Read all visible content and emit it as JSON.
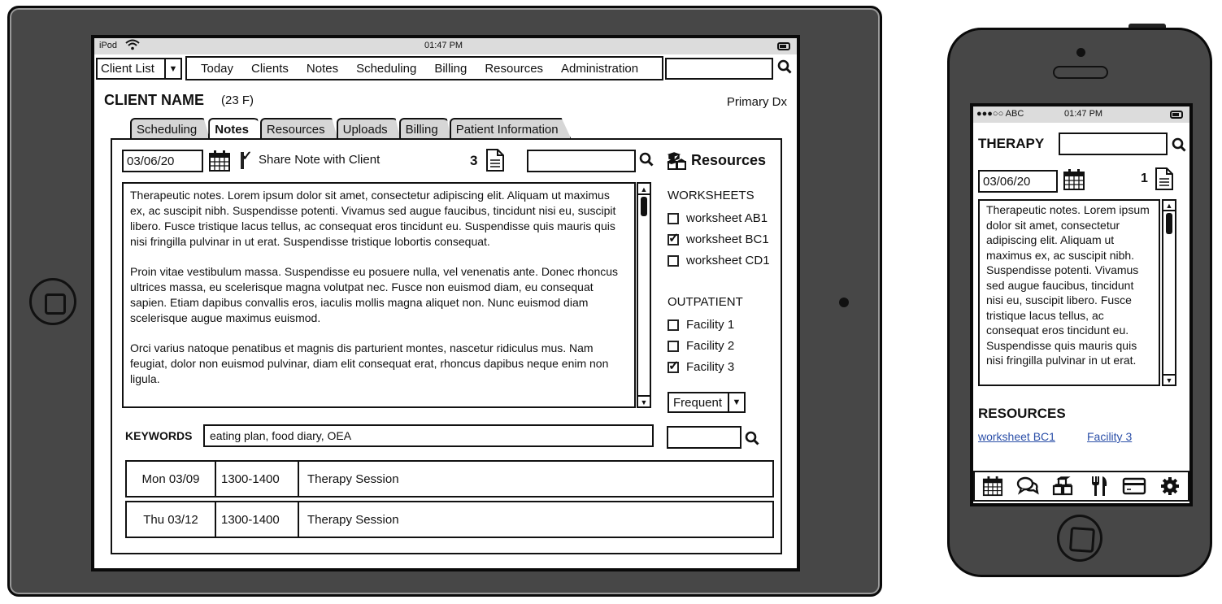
{
  "tablet": {
    "status_bar": {
      "carrier": "iPod",
      "time": "01:47 PM"
    },
    "nav": {
      "client_select": "Client List",
      "menu": [
        "Today",
        "Clients",
        "Notes",
        "Scheduling",
        "Billing",
        "Resources",
        "Administration"
      ],
      "search_placeholder": ""
    },
    "header": {
      "client_name": "CLIENT NAME",
      "client_info": "(23 F)",
      "primary_dx": "Primary Dx"
    },
    "tabs": [
      {
        "label": "Scheduling",
        "active": false
      },
      {
        "label": "Notes",
        "active": true
      },
      {
        "label": "Resources",
        "active": false
      },
      {
        "label": "Uploads",
        "active": false
      },
      {
        "label": "Billing",
        "active": false
      },
      {
        "label": "Patient Information",
        "active": false
      }
    ],
    "notes_panel": {
      "date": "03/06/20",
      "share_label": "Share Note with Client",
      "share_checked": true,
      "note_count": "3",
      "search_value": "",
      "paragraphs": [
        "Therapeutic notes. Lorem ipsum dolor sit amet, consectetur adipiscing elit. Aliquam ut maximus ex, ac suscipit nibh. Suspendisse potenti. Vivamus sed augue faucibus, tincidunt nisi eu, suscipit libero. Fusce tristique lacus tellus, ac consequat eros tincidunt eu. Suspendisse quis mauris quis nisi fringilla pulvinar in ut erat. Suspendisse tristique lobortis consequat.",
        "Proin vitae vestibulum massa. Suspendisse eu posuere nulla, vel venenatis ante. Donec rhoncus ultrices massa, eu scelerisque magna volutpat nec. Fusce non euismod diam, eu consequat sapien. Etiam dapibus convallis eros, iaculis mollis magna aliquet non. Nunc euismod diam scelerisque augue maximus euismod.",
        "Orci varius natoque penatibus et magnis dis parturient montes, nascetur ridiculus mus. Nam feugiat, dolor non euismod pulvinar, diam elit consequat erat, rhoncus dapibus neque enim non ligula."
      ],
      "keywords_label": "KEYWORDS",
      "keywords_value": "eating plan, food diary, OEA"
    },
    "resources": {
      "title": "Resources",
      "worksheets_heading": "WORKSHEETS",
      "worksheets": [
        {
          "label": "worksheet AB1",
          "checked": false
        },
        {
          "label": "worksheet BC1",
          "checked": true
        },
        {
          "label": "worksheet CD1",
          "checked": false
        }
      ],
      "outpatient_heading": "OUTPATIENT",
      "facilities": [
        {
          "label": "Facility 1",
          "checked": false
        },
        {
          "label": "Facility 2",
          "checked": false
        },
        {
          "label": "Facility 3",
          "checked": true
        }
      ],
      "frequency_select": "Frequent"
    },
    "schedule": [
      {
        "day": "Mon 03/09",
        "time": "1300-1400",
        "description": "Therapy Session"
      },
      {
        "day": "Thu 03/12",
        "time": "1300-1400",
        "description": "Therapy Session"
      }
    ]
  },
  "phone": {
    "status_bar": {
      "carrier": "●●●○○ ABC",
      "time": "01:47 PM"
    },
    "title": "THERAPY",
    "date": "03/06/20",
    "note_count": "1",
    "notes_text": "Therapeutic notes. Lorem ipsum dolor sit amet, consectetur adipiscing elit. Aliquam ut maximus ex, ac suscipit nibh. Suspendisse potenti. Vivamus sed augue faucibus, tincidunt nisi eu, suscipit libero. Fusce tristique lacus tellus, ac consequat eros tincidunt eu. Suspendisse quis mauris quis nisi fringilla pulvinar in ut erat.",
    "resources_heading": "RESOURCES",
    "resource_links": [
      "worksheet BC1",
      "Facility 3"
    ],
    "tab_bar_icons": [
      "calendar-icon",
      "chat-icon",
      "cubes-icon",
      "utensils-icon",
      "credit-card-icon",
      "gear-icon"
    ],
    "link_color": "#2b4fa8"
  }
}
